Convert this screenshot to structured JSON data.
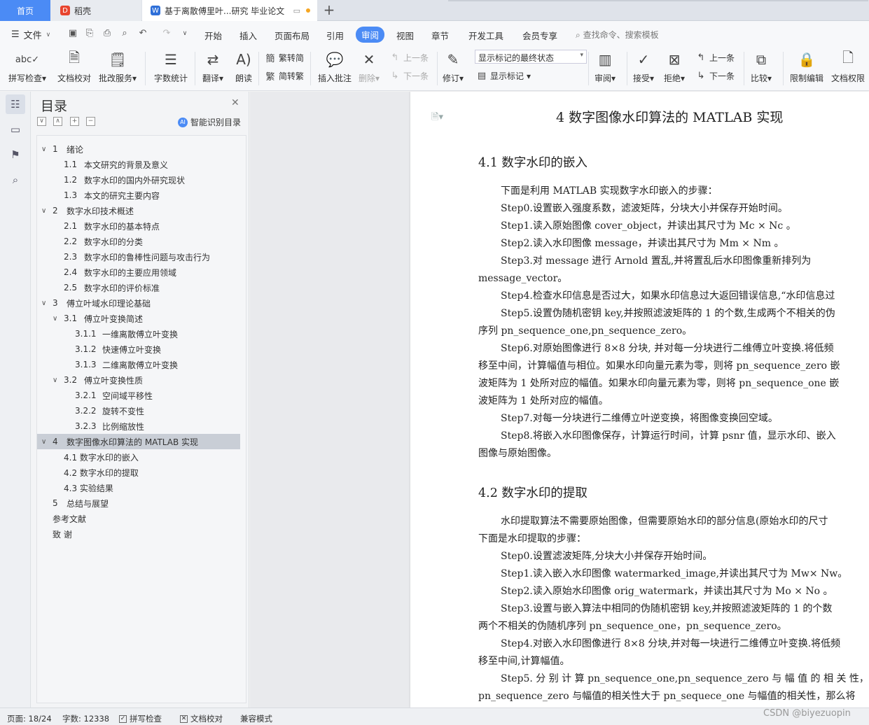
{
  "tabs": {
    "home": "首页",
    "shell": "稻壳",
    "doc": "基于离散傅里叶...研究 毕业论文"
  },
  "menu": {
    "file": "文件",
    "items": [
      "开始",
      "插入",
      "页面布局",
      "引用",
      "审阅",
      "视图",
      "章节",
      "开发工具",
      "会员专享"
    ],
    "active": "审阅",
    "search": "查找命令、搜索模板"
  },
  "ribbon": {
    "spell": "拼写检查",
    "proof": "文档校对",
    "revise": "批改服务",
    "wordcount": "字数统计",
    "translate": "翻译",
    "read": "朗读",
    "trad2simp": "繁转简",
    "simp2trad": "简转繁",
    "insert_comment": "插入批注",
    "delete": "删除",
    "prev_comment": "上一条",
    "next_comment": "下一条",
    "track": "修订",
    "markup_state": "显示标记的最终状态",
    "show_markup": "显示标记",
    "review": "审阅",
    "accept": "接受",
    "reject": "拒绝",
    "prev": "上一条",
    "next": "下一条",
    "compare": "比较",
    "restrict": "限制编辑",
    "permission": "文档权限"
  },
  "toc": {
    "title": "目录",
    "smart": "智能识别目录",
    "items": [
      {
        "num": "1",
        "text": "绪论",
        "level": 1,
        "arrow": "∨"
      },
      {
        "num": "1.1",
        "text": "本文研究的背景及意义",
        "level": 2
      },
      {
        "num": "1.2",
        "text": "数字水印的国内外研究现状",
        "level": 2
      },
      {
        "num": "1.3",
        "text": "本文的研究主要内容",
        "level": 2
      },
      {
        "num": "2",
        "text": "数字水印技术概述",
        "level": 1,
        "arrow": "∨"
      },
      {
        "num": "2.1",
        "text": "数字水印的基本特点",
        "level": 2
      },
      {
        "num": "2.2",
        "text": "数字水印的分类",
        "level": 2
      },
      {
        "num": "2.3",
        "text": "数字水印的鲁棒性问题与攻击行为",
        "level": 2
      },
      {
        "num": "2.4",
        "text": "数字水印的主要应用领域",
        "level": 2
      },
      {
        "num": "2.5",
        "text": "数字水印的评价标准",
        "level": 2
      },
      {
        "num": "3",
        "text": "傅立叶域水印理论基础",
        "level": 1,
        "arrow": "∨"
      },
      {
        "num": "3.1",
        "text": "傅立叶变换简述",
        "level": 2,
        "arrow": "∨"
      },
      {
        "num": "3.1.1",
        "text": "一维离散傅立叶变换",
        "level": 3
      },
      {
        "num": "3.1.2",
        "text": "快速傅立叶变换",
        "level": 3
      },
      {
        "num": "3.1.3",
        "text": "二维离散傅立叶变换",
        "level": 3
      },
      {
        "num": "3.2",
        "text": "傅立叶变换性质",
        "level": 2,
        "arrow": "∨"
      },
      {
        "num": "3.2.1",
        "text": "空间域平移性",
        "level": 3
      },
      {
        "num": "3.2.2",
        "text": "旋转不变性",
        "level": 3
      },
      {
        "num": "3.2.3",
        "text": "比例缩放性",
        "level": 3
      },
      {
        "num": "4",
        "text": "数字图像水印算法的 MATLAB  实现",
        "level": 1,
        "arrow": "∨",
        "selected": true
      },
      {
        "num": "",
        "text": "4.1 数字水印的嵌入",
        "level": 2
      },
      {
        "num": "",
        "text": "4.2 数字水印的提取",
        "level": 2
      },
      {
        "num": "",
        "text": "4.3 实验结果",
        "level": 2
      },
      {
        "num": "5",
        "text": "总结与展望",
        "level": 1
      },
      {
        "num": "",
        "text": "参考文献",
        "level": 0
      },
      {
        "num": "",
        "text": "致   谢",
        "level": 0
      }
    ]
  },
  "document": {
    "chapter_title": "4    数字图像水印算法的 MATLAB  实现",
    "sections": [
      {
        "title": "4.1 数字水印的嵌入",
        "lines": [
          {
            "t": "下面是利用 MATLAB 实现数字水印嵌入的步骤：",
            "i": true
          },
          {
            "t": "Step0.设置嵌入强度系数，滤波矩阵，分块大小并保存开始时间。",
            "i": true
          },
          {
            "t": "Step1.读入原始图像 cover_object，并读出其尺寸为 Mc × Nc 。",
            "i": true
          },
          {
            "t": "Step2.读入水印图像 message，并读出其尺寸为 Mm × Nm 。",
            "i": true
          },
          {
            "t": "Step3.对 message 进行 Arnold 置乱,并将置乱后水印图像重新排列为",
            "i": true
          },
          {
            "t": "message_vector。",
            "i": false
          },
          {
            "t": "Step4.检查水印信息是否过大，如果水印信息过大返回错误信息,“水印信息过",
            "i": true
          },
          {
            "t": "Step5.设置伪随机密钥 key,并按照滤波矩阵的 1 的个数,生成两个不相关的伪",
            "i": true
          },
          {
            "t": "序列 pn_sequence_one,pn_sequence_zero。",
            "i": false
          },
          {
            "t": "Step6.对原始图像进行 8×8 分块, 并对每一分块进行二维傅立叶变换.将低频",
            "i": true
          },
          {
            "t": "移至中间，计算幅值与相位。如果水印向量元素为零，则将 pn_sequence_zero 嵌",
            "i": false
          },
          {
            "t": "波矩阵为 1 处所对应的幅值。如果水印向量元素为零，则将 pn_sequence_one 嵌",
            "i": false
          },
          {
            "t": "波矩阵为 1 处所对应的幅值。",
            "i": false
          },
          {
            "t": "Step7.对每一分块进行二维傅立叶逆变换，将图像变换回空域。",
            "i": true
          },
          {
            "t": "Step8.将嵌入水印图像保存，计算运行时间，计算 psnr 值，显示水印、嵌入",
            "i": true
          },
          {
            "t": "图像与原始图像。",
            "i": false
          }
        ]
      },
      {
        "title": "4.2 数字水印的提取",
        "lines": [
          {
            "t": "水印提取算法不需要原始图像，但需要原始水印的部分信息(原始水印的尺寸",
            "i": true
          },
          {
            "t": "下面是水印提取的步骤：",
            "i": false
          },
          {
            "t": "Step0.设置滤波矩阵,分块大小并保存开始时间。",
            "i": true
          },
          {
            "t": "Step1.读入嵌入水印图像 watermarked_image,并读出其尺寸为 Mw× Nw。",
            "i": true
          },
          {
            "t": "Step2.读入原始水印图像 orig_watermark，并读出其尺寸为 Mo × No 。",
            "i": true
          },
          {
            "t": "Step3.设置与嵌入算法中相同的伪随机密钥 key,并按照滤波矩阵的 1 的个数",
            "i": true
          },
          {
            "t": "两个不相关的伪随机序列 pn_sequence_one，pn_sequence_zero。",
            "i": false
          },
          {
            "t": "Step4.对嵌入水印图像进行 8×8 分块,并对每一块进行二维傅立叶变换.将低频",
            "i": true
          },
          {
            "t": "移至中间,计算幅值。",
            "i": false
          },
          {
            "t": "Step5. 分 别 计 算  pn_sequence_one,pn_sequence_zero 与 幅 值 的 相 关 性，",
            "i": true
          },
          {
            "t": "pn_sequence_zero 与幅值的相关性大于 pn_sequece_one 与幅值的相关性，那么将",
            "i": false
          }
        ]
      }
    ]
  },
  "status": {
    "page": "页面: 18/24",
    "words": "字数: 12338",
    "spell": "拼写检查",
    "proof": "文档校对",
    "compat": "兼容模式"
  },
  "watermark": "CSDN @biyezuopin"
}
